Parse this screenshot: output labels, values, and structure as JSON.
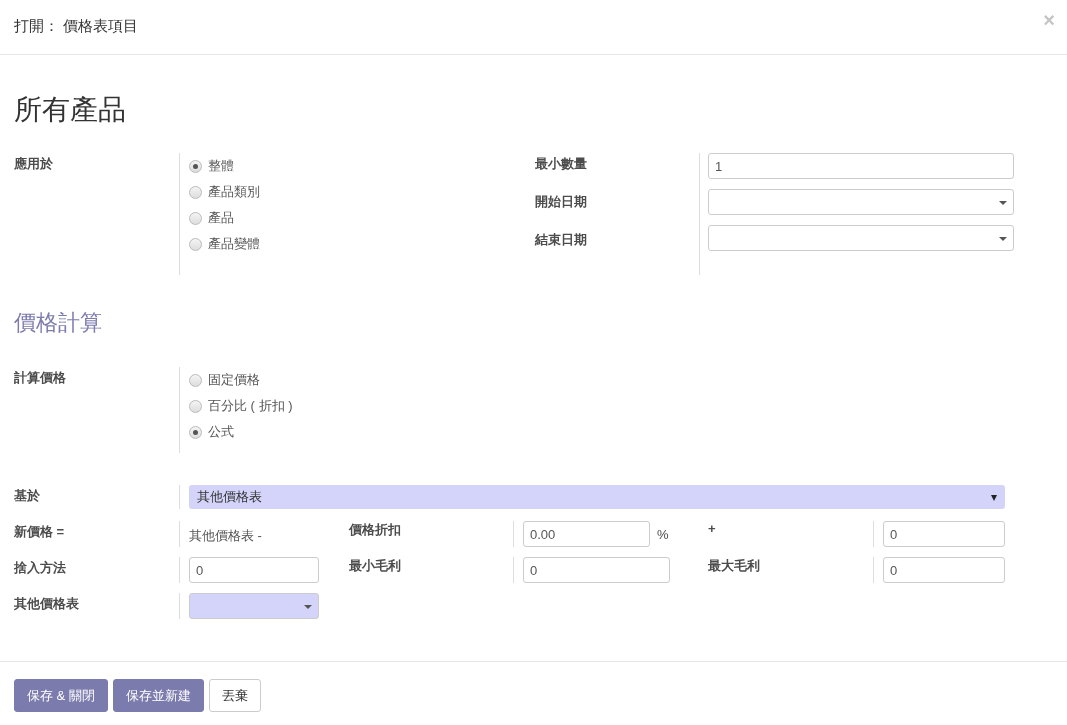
{
  "dialog": {
    "title": "打開： 價格表項目",
    "close": "×"
  },
  "heading": "所有產品",
  "apply": {
    "label": "應用於",
    "options": [
      {
        "label": "整體",
        "selected": true
      },
      {
        "label": "產品類別",
        "selected": false
      },
      {
        "label": "產品",
        "selected": false
      },
      {
        "label": "產品變體",
        "selected": false
      }
    ]
  },
  "conditions": [
    {
      "label": "最小數量",
      "kind": "text",
      "value": "1"
    },
    {
      "label": "開始日期",
      "kind": "date"
    },
    {
      "label": "結束日期",
      "kind": "date"
    }
  ],
  "section_title": "價格計算",
  "compute": {
    "label": "計算價格",
    "options": [
      {
        "label": "固定價格",
        "selected": false
      },
      {
        "label": "百分比 ( 折扣 )",
        "selected": false
      },
      {
        "label": "公式",
        "selected": true
      }
    ]
  },
  "formula": {
    "base": {
      "label": "基於",
      "value": "其他價格表"
    },
    "new_price": {
      "label": "新價格 =",
      "text": "其他價格表 -"
    },
    "discount": {
      "label": "價格折扣",
      "value": "0.00",
      "unit": "%"
    },
    "surcharge": {
      "label": "+",
      "value": "0"
    },
    "rounding": {
      "label": "捨入方法",
      "value": "0"
    },
    "min_margin": {
      "label": "最小毛利",
      "value": "0"
    },
    "max_margin": {
      "label": "最大毛利",
      "value": "0"
    },
    "other_pricelist": {
      "label": "其他價格表"
    }
  },
  "buttons": [
    {
      "label": "保存 & 關閉",
      "kind": "primary"
    },
    {
      "label": "保存並新建",
      "kind": "primary"
    },
    {
      "label": "丟棄",
      "kind": "secondary"
    }
  ]
}
